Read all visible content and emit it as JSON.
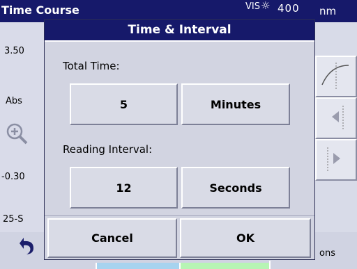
{
  "titlebar": {
    "title": "Time Course",
    "mode": "VIS",
    "sun_icon": "☼",
    "wavelength": "400",
    "unit": "nm"
  },
  "plot": {
    "y_max": "3.50",
    "y_unit": "Abs",
    "y_min": "-0.30",
    "x_start": "25-S"
  },
  "side_buttons": [
    "curve-icon",
    "arrow-left-icon",
    "arrow-right-icon"
  ],
  "bottom": {
    "options_label": "ons"
  },
  "dialog": {
    "title": "Time & Interval",
    "total_time_label": "Total Time:",
    "total_time_value": "5",
    "total_time_unit": "Minutes",
    "reading_interval_label": "Reading Interval:",
    "reading_interval_value": "12",
    "reading_interval_unit": "Seconds",
    "cancel_label": "Cancel",
    "ok_label": "OK"
  },
  "colors": {
    "title_bar": "#16196a",
    "dialog_bg": "#d2d4e1",
    "tab_blue": "#a7d3ef",
    "tab_green": "#b7f4b4"
  }
}
